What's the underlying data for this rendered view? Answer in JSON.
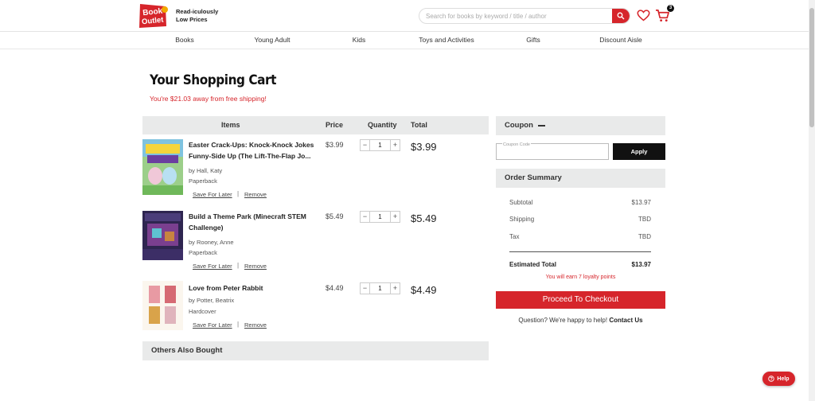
{
  "brand": {
    "logo_line1": "Book",
    "logo_line2": "Outlet",
    "tagline_line1": "Read-iculously",
    "tagline_line2": "Low Prices",
    "color": "#d6252b"
  },
  "search": {
    "placeholder": "Search for books by keyword / title / author"
  },
  "header": {
    "cart_count": "3"
  },
  "nav": [
    "Books",
    "Young Adult",
    "Kids",
    "Toys and Activities",
    "Gifts",
    "Discount Aisle"
  ],
  "cart": {
    "title": "Your Shopping Cart",
    "free_shipping": "You're $21.03 away from free shipping!",
    "columns": {
      "items": "Items",
      "price": "Price",
      "quantity": "Quantity",
      "total": "Total"
    },
    "items": [
      {
        "title": "Easter Crack-Ups: Knock-Knock Jokes Funny-Side Up (The Lift-The-Flap Jo...",
        "author": "by Hall, Katy",
        "format": "Paperback",
        "price": "$3.99",
        "qty": "1",
        "total": "$3.99",
        "save": "Save For Later",
        "remove": "Remove"
      },
      {
        "title": "Build a Theme Park (Minecraft STEM Challenge)",
        "author": "by Rooney, Anne",
        "format": "Paperback",
        "price": "$5.49",
        "qty": "1",
        "total": "$5.49",
        "save": "Save For Later",
        "remove": "Remove"
      },
      {
        "title": "Love from Peter Rabbit",
        "author": "by Potter, Beatrix",
        "format": "Hardcover",
        "price": "$4.49",
        "qty": "1",
        "total": "$4.49",
        "save": "Save For Later",
        "remove": "Remove"
      }
    ],
    "qty_minus": "−",
    "qty_plus": "+",
    "others": "Others Also Bought"
  },
  "coupon": {
    "title": "Coupon",
    "placeholder": "Coupon Code",
    "apply": "Apply"
  },
  "summary": {
    "title": "Order Summary",
    "subtotal_label": "Subtotal",
    "subtotal": "$13.97",
    "shipping_label": "Shipping",
    "shipping": "TBD",
    "tax_label": "Tax",
    "tax": "TBD",
    "estimated_label": "Estimated Total",
    "estimated": "$13.97",
    "loyalty": "You will earn 7 loyalty points",
    "checkout": "Proceed To Checkout",
    "question": "Question? We're happy to help!",
    "contact": "Contact Us"
  },
  "help": "Help"
}
